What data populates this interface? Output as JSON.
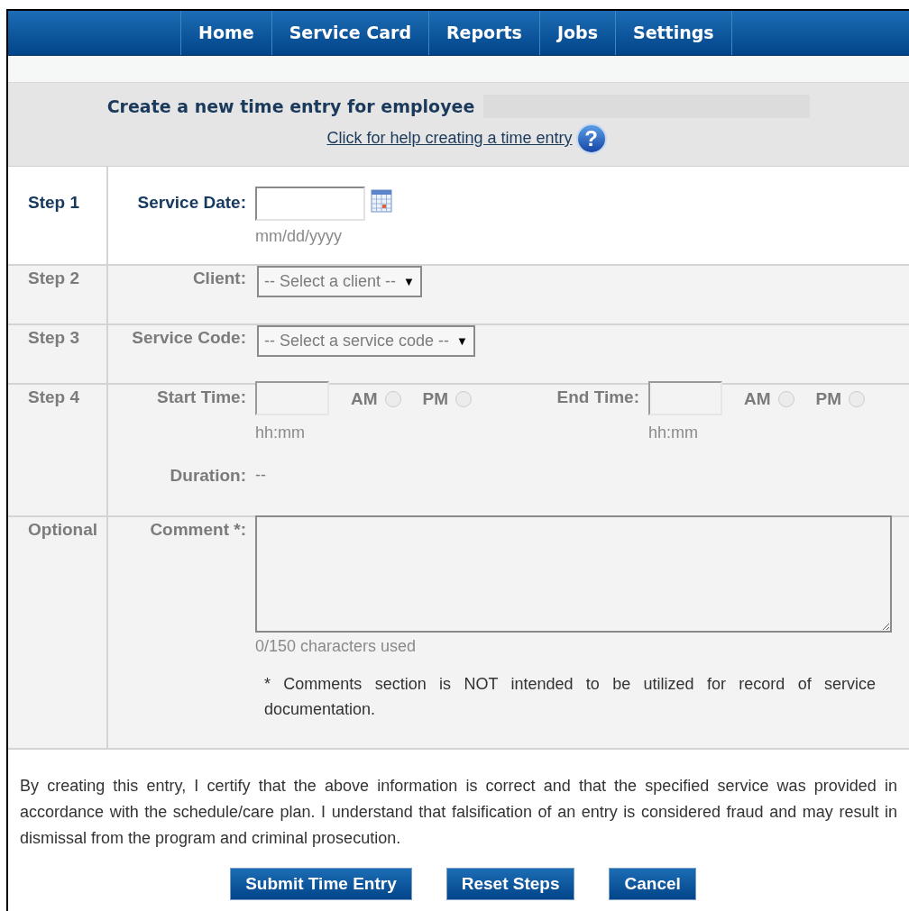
{
  "nav": {
    "items": [
      {
        "label": "Home"
      },
      {
        "label": "Service Card"
      },
      {
        "label": "Reports"
      },
      {
        "label": "Jobs"
      },
      {
        "label": "Settings"
      }
    ]
  },
  "header": {
    "title": "Create a new time entry for employee",
    "help_link": "Click for help creating a time entry",
    "help_icon": "?"
  },
  "steps": [
    {
      "kind": "date",
      "step": "Step 1",
      "active": true,
      "label": "Service Date:",
      "hint": "mm/dd/yyyy"
    },
    {
      "kind": "select",
      "step": "Step 2",
      "active": false,
      "label": "Client:",
      "option": "-- Select a client --",
      "arrow": "▼"
    },
    {
      "kind": "select",
      "step": "Step 3",
      "active": false,
      "label": "Service Code:",
      "option": "-- Select a service code --",
      "arrow": "▼"
    },
    {
      "kind": "time",
      "step": "Step 4",
      "active": false,
      "times": [
        {
          "label": "Start Time:",
          "hint": "hh:mm",
          "options": [
            {
              "label": "AM",
              "checked": false
            },
            {
              "label": "PM",
              "checked": false
            }
          ]
        },
        {
          "label": "End Time:",
          "hint": "hh:mm",
          "options": [
            {
              "label": "AM",
              "checked": false
            },
            {
              "label": "PM",
              "checked": false
            }
          ]
        }
      ],
      "duration_label": "Duration:",
      "duration_value": "--"
    },
    {
      "kind": "comment",
      "step": "Optional",
      "active": false,
      "label": "Comment *:",
      "counter": "0/150 characters used",
      "note": "* Comments section is NOT intended to be utilized for record of service documentation."
    }
  ],
  "disclaimer": "By creating this entry, I certify that the above information is correct and that the specified service was provided in accordance with the schedule/care plan. I understand that falsification of an entry is considered fraud and may result in dismissal from the program and criminal prosecution.",
  "buttons": [
    "Submit Time Entry",
    "Reset Steps",
    "Cancel"
  ]
}
